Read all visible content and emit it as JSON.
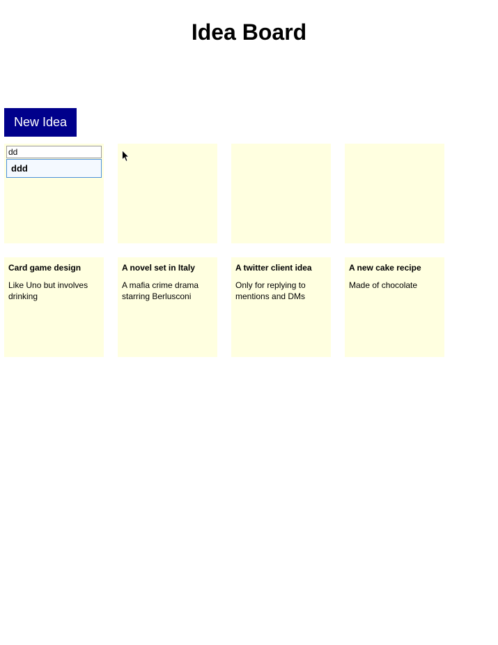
{
  "title": "Idea Board",
  "new_idea_button": "New Idea",
  "editing_card": {
    "input_value": "dd",
    "autocomplete": "ddd"
  },
  "cards_row1": [
    {
      "title": "",
      "desc": ""
    },
    {
      "title": "",
      "desc": ""
    },
    {
      "title": "",
      "desc": ""
    }
  ],
  "cards_row2": [
    {
      "title": "Card game design",
      "desc": "Like Uno but involves drinking"
    },
    {
      "title": "A novel set in Italy",
      "desc": "A mafia crime drama starring Berlusconi"
    },
    {
      "title": "A twitter client idea",
      "desc": "Only for replying to mentions and DMs"
    },
    {
      "title": "A new cake recipe",
      "desc": "Made of chocolate"
    }
  ]
}
